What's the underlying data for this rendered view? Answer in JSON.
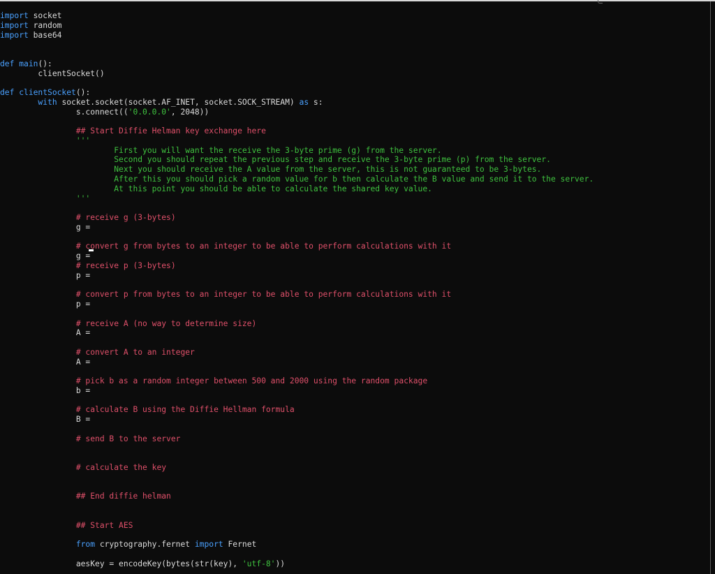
{
  "lines": [
    [
      {
        "t": "import",
        "c": "kw"
      },
      {
        "t": " socket"
      }
    ],
    [
      {
        "t": "import",
        "c": "kw"
      },
      {
        "t": " random"
      }
    ],
    [
      {
        "t": "import",
        "c": "kw"
      },
      {
        "t": " base64"
      }
    ],
    [],
    [],
    [
      {
        "t": "def",
        "c": "kw"
      },
      {
        "t": " "
      },
      {
        "t": "main",
        "c": "fn"
      },
      {
        "t": "():"
      }
    ],
    [
      {
        "t": "        clientSocket()"
      }
    ],
    [],
    [
      {
        "t": "def",
        "c": "kw"
      },
      {
        "t": " "
      },
      {
        "t": "clientSocket",
        "c": "fn"
      },
      {
        "t": "():"
      }
    ],
    [
      {
        "t": "        "
      },
      {
        "t": "with",
        "c": "kw"
      },
      {
        "t": " socket.socket(socket.AF_INET, socket.SOCK_STREAM) "
      },
      {
        "t": "as",
        "c": "kw"
      },
      {
        "t": " s:"
      }
    ],
    [
      {
        "t": "                s.connect(("
      },
      {
        "t": "'0.0.0.0'",
        "c": "str"
      },
      {
        "t": ", 2048))"
      }
    ],
    [],
    [
      {
        "t": "                "
      },
      {
        "t": "## Start Diffie Helman key exchange here",
        "c": "cmt"
      }
    ],
    [
      {
        "t": "                "
      },
      {
        "t": "'''",
        "c": "doc"
      }
    ],
    [
      {
        "t": "                        "
      },
      {
        "t": "First you will want the receive the 3-byte prime (g) from the server.",
        "c": "doc"
      }
    ],
    [
      {
        "t": "                        "
      },
      {
        "t": "Second you should repeat the previous step and receive the 3-byte prime (p) from the server.",
        "c": "doc"
      }
    ],
    [
      {
        "t": "                        "
      },
      {
        "t": "Next you should receive the A value from the server, this is not guaranteed to be 3-bytes.",
        "c": "doc"
      }
    ],
    [
      {
        "t": "                        "
      },
      {
        "t": "After this you should pick a random value for b then calculate the B value and send it to the server.",
        "c": "doc"
      }
    ],
    [
      {
        "t": "                        "
      },
      {
        "t": "At this point you should be able to calculate the shared key value.",
        "c": "doc"
      }
    ],
    [
      {
        "t": "                "
      },
      {
        "t": "'''",
        "c": "doc"
      }
    ],
    [],
    [
      {
        "t": "                "
      },
      {
        "t": "# receive g (3-bytes)",
        "c": "cmt"
      }
    ],
    [
      {
        "t": "                g ="
      }
    ],
    [],
    [
      {
        "t": "                "
      },
      {
        "t": "# convert g from bytes to an integer to be able to perform calculations with it",
        "c": "cmt"
      }
    ],
    [
      {
        "t": "                g ="
      }
    ],
    [
      {
        "t": "                "
      },
      {
        "t": "# receive p (3-bytes)",
        "c": "cmt"
      }
    ],
    [
      {
        "t": "                p ="
      }
    ],
    [],
    [
      {
        "t": "                "
      },
      {
        "t": "# convert p from bytes to an integer to be able to perform calculations with it",
        "c": "cmt"
      }
    ],
    [
      {
        "t": "                p ="
      }
    ],
    [],
    [
      {
        "t": "                "
      },
      {
        "t": "# receive A (no way to determine size)",
        "c": "cmt"
      }
    ],
    [
      {
        "t": "                A ="
      }
    ],
    [],
    [
      {
        "t": "                "
      },
      {
        "t": "# convert A to an integer",
        "c": "cmt"
      }
    ],
    [
      {
        "t": "                A ="
      }
    ],
    [],
    [
      {
        "t": "                "
      },
      {
        "t": "# pick b as a random integer between 500 and 2000 using the random package",
        "c": "cmt"
      }
    ],
    [
      {
        "t": "                b ="
      }
    ],
    [],
    [
      {
        "t": "                "
      },
      {
        "t": "# calculate B using the Diffie Hellman formula",
        "c": "cmt"
      }
    ],
    [
      {
        "t": "                B ="
      }
    ],
    [],
    [
      {
        "t": "                "
      },
      {
        "t": "# send B to the server",
        "c": "cmt"
      }
    ],
    [],
    [],
    [
      {
        "t": "                "
      },
      {
        "t": "# calculate the key",
        "c": "cmt"
      }
    ],
    [],
    [],
    [
      {
        "t": "                "
      },
      {
        "t": "## End diffie helman",
        "c": "cmt"
      }
    ],
    [],
    [],
    [
      {
        "t": "                "
      },
      {
        "t": "## Start AES",
        "c": "cmt"
      }
    ],
    [],
    [
      {
        "t": "                "
      },
      {
        "t": "from",
        "c": "kw"
      },
      {
        "t": " cryptography.fernet "
      },
      {
        "t": "import",
        "c": "kw"
      },
      {
        "t": " Fernet"
      }
    ],
    [],
    [
      {
        "t": "                aesKey = encodeKey(bytes(str(key), "
      },
      {
        "t": "'utf-8'",
        "c": "str"
      },
      {
        "t": "))"
      }
    ]
  ]
}
